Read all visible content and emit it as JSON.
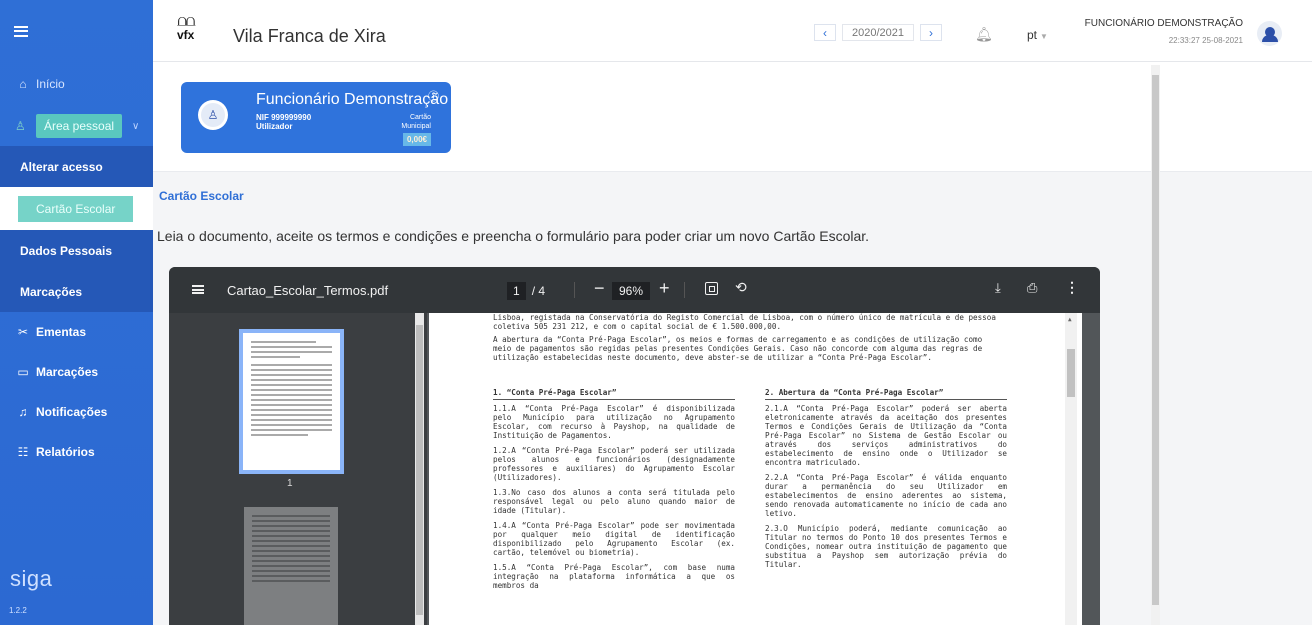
{
  "sidebar": {
    "nav": [
      {
        "label": "Início",
        "icon": "home-icon"
      },
      {
        "label": "Área pessoal",
        "icon": "user-icon"
      }
    ],
    "sub_items": [
      {
        "label": "Alterar acesso"
      },
      {
        "label": "Cartão Escolar"
      },
      {
        "label": "Dados Pessoais"
      },
      {
        "label": "Marcações"
      }
    ],
    "bottom_items": [
      {
        "label": "Ementas",
        "icon": "cutlery-icon"
      },
      {
        "label": "Marcações",
        "icon": "calendar-icon"
      },
      {
        "label": "Notificações",
        "icon": "bell-icon"
      },
      {
        "label": "Relatórios",
        "icon": "report-icon"
      }
    ],
    "brand": "siga",
    "version": "1.2.2"
  },
  "header": {
    "municipality": "Vila Franca de Xira",
    "logo_text": "vfx",
    "school_year": "2020/2021",
    "language": "pt",
    "user_name": "FUNCIONÁRIO DEMONSTRAÇÃO",
    "timestamp": "22:33:27 25-08-2021"
  },
  "user_card": {
    "name": "Funcionário Demonstração",
    "nif": "NIF 999999990",
    "role": "Utilizador",
    "cartao_line1": "Cartão",
    "cartao_line2": "Municipal",
    "balance": "0,00€"
  },
  "content": {
    "section_title": "Cartão Escolar",
    "intro": "Leia o documento, aceite os termos e condições e preencha o formulário para poder criar um novo Cartão Escolar."
  },
  "pdf": {
    "filename": "Cartao_Escolar_Termos.pdf",
    "current_page": "1",
    "total_pages": "/ 4",
    "zoom": "96%",
    "thumb_label": "1",
    "intro_text": "Lisboa, registada na Conservatória do Registo Comercial de Lisboa, com o número único de matrícula e de pessoa coletiva 505 231 212, e com o capital social de € 1.500.000,00.",
    "intro_text2": "A abertura da “Conta Pré-Paga Escolar”, os meios e formas de carregamento e as condições de utilização como meio de pagamentos são regidas pelas presentes Condições Gerais. Caso não concorde com alguma das regras de utilização estabelecidas neste documento, deve abster-se de utilizar a “Conta Pré-Paga Escolar”.",
    "col1_title": "1.  “Conta Pré-Paga Escolar”",
    "col1": [
      "1.1.A “Conta Pré-Paga Escolar” é disponibilizada pelo Município para utilização no Agrupamento Escolar, com recurso à Payshop, na qualidade de Instituição de Pagamentos.",
      "1.2.A “Conta Pré-Paga Escolar” poderá ser utilizada pelos alunos e funcionários (designadamente professores e auxiliares) do Agrupamento Escolar (Utilizadores).",
      "1.3.No caso dos alunos a conta será titulada pelo responsável legal ou pelo aluno quando maior de idade (Titular).",
      "1.4.A “Conta Pré-Paga Escolar” pode ser movimentada por qualquer meio digital de identificação disponibilizado pelo Agrupamento Escolar (ex. cartão, telemóvel ou biometria).",
      "1.5.A “Conta Pré-Paga Escolar”, com base numa integração na plataforma informática a que os membros da"
    ],
    "col2_title": "2.  Abertura da “Conta Pré-Paga Escolar”",
    "col2": [
      "2.1.A “Conta Pré-Paga Escolar” poderá ser aberta eletronicamente através da aceitação dos presentes Termos e Condições Gerais de Utilização da “Conta Pré-Paga Escolar” no Sistema de Gestão Escolar ou através dos serviços administrativos do estabelecimento de ensino onde o Utilizador se encontra matriculado.",
      "2.2.A “Conta Pré-Paga Escolar” é válida enquanto durar a permanência do seu Utilizador em estabelecimentos de ensino aderentes ao sistema, sendo renovada automaticamente no início de cada ano letivo.",
      "2.3.O Município poderá, mediante comunicação ao Titular no termos do Ponto 10 dos presentes Termos e Condições, nomear outra instituição de pagamento que substitua a Payshop sem autorização prévia do Titular."
    ]
  },
  "colors": {
    "sidebar": "#2f6fd6",
    "accent_teal": "#5ac7bf",
    "card": "#2f73dc",
    "pdf_toolbar": "#323639"
  }
}
